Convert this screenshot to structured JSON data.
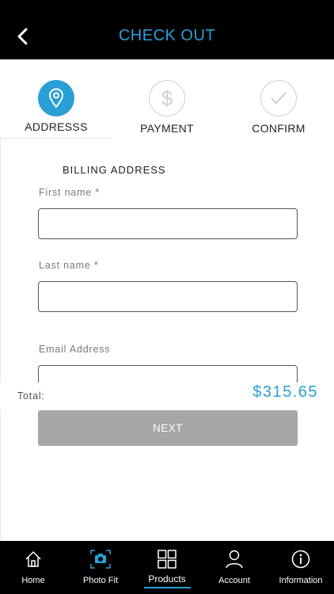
{
  "header": {
    "title": "CHECK OUT",
    "back_icon": "chevron-left-icon"
  },
  "steps": [
    {
      "label": "ADDRESSS",
      "icon": "location-pin-icon",
      "active": true
    },
    {
      "label": "PAYMENT",
      "icon": "dollar-icon",
      "active": false
    },
    {
      "label": "CONFIRM",
      "icon": "checkmark-icon",
      "active": false
    }
  ],
  "form": {
    "section_title": "BILLING ADDRESS",
    "first_name_label": "First name *",
    "first_name_value": "",
    "last_name_label": "Last name *",
    "last_name_value": "",
    "email_label": "Email Address",
    "email_value": ""
  },
  "total": {
    "label": "Total:",
    "value": "$315.65"
  },
  "next_label": "NEXT",
  "tabbar": {
    "items": [
      {
        "label": "Home",
        "icon": "home-icon"
      },
      {
        "label": "Photo Fit",
        "icon": "camera-icon"
      },
      {
        "label": "Products",
        "icon": "grid-icon",
        "active": true
      },
      {
        "label": "Account",
        "icon": "person-icon"
      },
      {
        "label": "Information",
        "icon": "info-icon"
      }
    ]
  },
  "colors": {
    "accent": "#2a9fd6",
    "header_bg": "#000000",
    "button_disabled": "#a6a6a6"
  }
}
